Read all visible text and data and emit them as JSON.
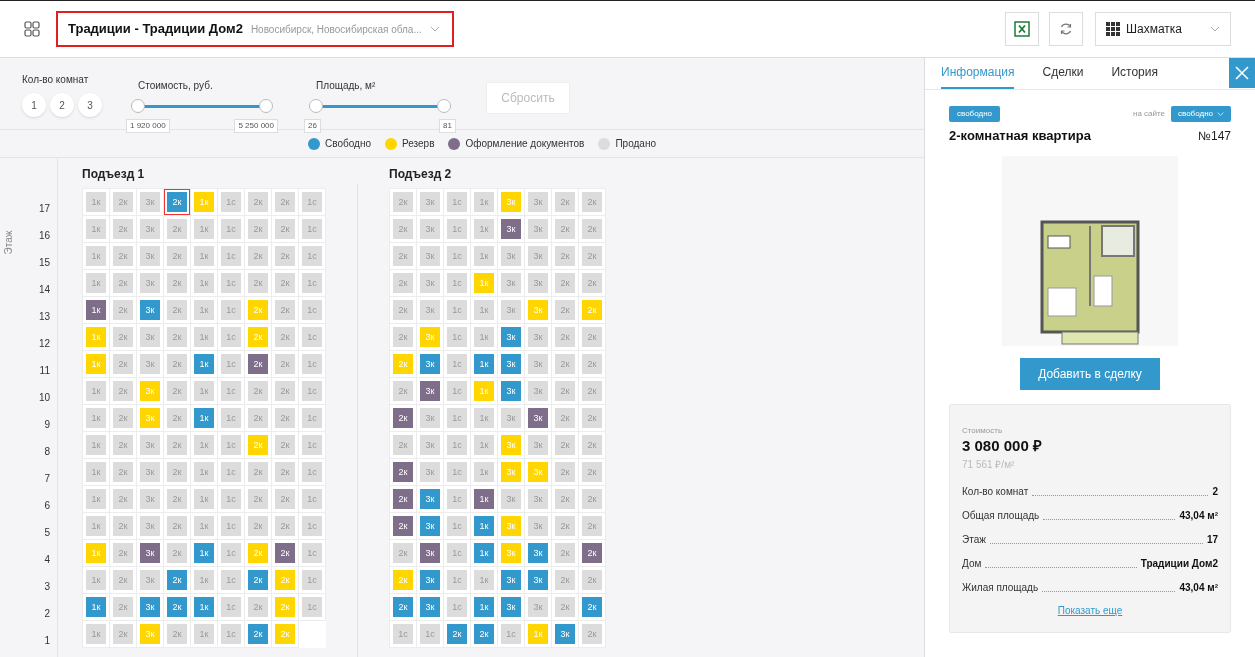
{
  "header": {
    "project": "Традиции - Традиции Дом2",
    "location": "Новосибирск, Новосибирская обла...",
    "view": "Шахматка"
  },
  "filters": {
    "rooms_label": "Кол-во комнат",
    "rooms": [
      {
        "label": "1",
        "selected": false
      },
      {
        "label": "2",
        "selected": false
      },
      {
        "label": "3",
        "selected": false
      }
    ],
    "sliders": [
      {
        "label": "Стоимость, руб.",
        "thumbs": [
          {
            "level": 0,
            "reading": "1 920 000"
          },
          {
            "level": 1,
            "reading": "5 250 000"
          }
        ]
      },
      {
        "label": "Площадь, м²",
        "thumbs": [
          {
            "level": 0,
            "reading": "26"
          },
          {
            "level": 1,
            "reading": "81"
          }
        ]
      }
    ],
    "reset": "Сбросить"
  },
  "legend": [
    {
      "kind": "free",
      "label": "Свободно",
      "color": "#3399cc"
    },
    {
      "kind": "reserve",
      "label": "Резерв",
      "color": "#ffd600"
    },
    {
      "kind": "docs",
      "label": "Оформление документов",
      "color": "#7e6e8a"
    },
    {
      "kind": "sold",
      "label": "Продано",
      "color": "#dcdcdc"
    }
  ],
  "floor_axis": "Этаж",
  "floors": [
    "17",
    "16",
    "15",
    "14",
    "13",
    "12",
    "11",
    "10",
    "9",
    "8",
    "7",
    "6",
    "5",
    "4",
    "3",
    "2",
    "1"
  ],
  "sections": [
    {
      "title": "Подъезд 1",
      "rows": [
        [
          {
            "label": "1к",
            "kind": "sold",
            "selected": false
          },
          {
            "label": "2к",
            "kind": "sold",
            "selected": false
          },
          {
            "label": "3к",
            "kind": "sold",
            "selected": false
          },
          {
            "label": "2к",
            "kind": "free",
            "selected": true
          },
          {
            "label": "1к",
            "kind": "reserve",
            "selected": false
          },
          {
            "label": "1с",
            "kind": "sold",
            "selected": false
          },
          {
            "label": "2к",
            "kind": "sold",
            "selected": false
          },
          {
            "label": "2к",
            "kind": "sold",
            "selected": false
          },
          {
            "label": "1с",
            "kind": "sold",
            "selected": false
          }
        ],
        [
          {
            "label": "1к",
            "kind": "sold",
            "selected": false
          },
          {
            "label": "2к",
            "kind": "sold",
            "selected": false
          },
          {
            "label": "3к",
            "kind": "sold",
            "selected": false
          },
          {
            "label": "2к",
            "kind": "sold",
            "selected": false
          },
          {
            "label": "1к",
            "kind": "sold",
            "selected": false
          },
          {
            "label": "1с",
            "kind": "sold",
            "selected": false
          },
          {
            "label": "2к",
            "kind": "sold",
            "selected": false
          },
          {
            "label": "2к",
            "kind": "sold",
            "selected": false
          },
          {
            "label": "1с",
            "kind": "sold",
            "selected": false
          }
        ],
        [
          {
            "label": "1к",
            "kind": "sold",
            "selected": false
          },
          {
            "label": "2к",
            "kind": "sold",
            "selected": false
          },
          {
            "label": "3к",
            "kind": "sold",
            "selected": false
          },
          {
            "label": "2к",
            "kind": "sold",
            "selected": false
          },
          {
            "label": "1к",
            "kind": "sold",
            "selected": false
          },
          {
            "label": "1с",
            "kind": "sold",
            "selected": false
          },
          {
            "label": "2к",
            "kind": "sold",
            "selected": false
          },
          {
            "label": "2к",
            "kind": "sold",
            "selected": false
          },
          {
            "label": "1с",
            "kind": "sold",
            "selected": false
          }
        ],
        [
          {
            "label": "1к",
            "kind": "sold",
            "selected": false
          },
          {
            "label": "2к",
            "kind": "sold",
            "selected": false
          },
          {
            "label": "3к",
            "kind": "sold",
            "selected": false
          },
          {
            "label": "2к",
            "kind": "sold",
            "selected": false
          },
          {
            "label": "1к",
            "kind": "sold",
            "selected": false
          },
          {
            "label": "1с",
            "kind": "sold",
            "selected": false
          },
          {
            "label": "2к",
            "kind": "sold",
            "selected": false
          },
          {
            "label": "2к",
            "kind": "sold",
            "selected": false
          },
          {
            "label": "1с",
            "kind": "sold",
            "selected": false
          }
        ],
        [
          {
            "label": "1к",
            "kind": "docs",
            "selected": false
          },
          {
            "label": "2к",
            "kind": "sold",
            "selected": false
          },
          {
            "label": "3к",
            "kind": "free",
            "selected": false
          },
          {
            "label": "2к",
            "kind": "sold",
            "selected": false
          },
          {
            "label": "1к",
            "kind": "sold",
            "selected": false
          },
          {
            "label": "1с",
            "kind": "sold",
            "selected": false
          },
          {
            "label": "2к",
            "kind": "reserve",
            "selected": false
          },
          {
            "label": "2к",
            "kind": "sold",
            "selected": false
          },
          {
            "label": "1с",
            "kind": "sold",
            "selected": false
          }
        ],
        [
          {
            "label": "1к",
            "kind": "reserve",
            "selected": false
          },
          {
            "label": "2к",
            "kind": "sold",
            "selected": false
          },
          {
            "label": "3к",
            "kind": "sold",
            "selected": false
          },
          {
            "label": "2к",
            "kind": "sold",
            "selected": false
          },
          {
            "label": "1к",
            "kind": "sold",
            "selected": false
          },
          {
            "label": "1с",
            "kind": "sold",
            "selected": false
          },
          {
            "label": "2к",
            "kind": "reserve",
            "selected": false
          },
          {
            "label": "2к",
            "kind": "sold",
            "selected": false
          },
          {
            "label": "1с",
            "kind": "sold",
            "selected": false
          }
        ],
        [
          {
            "label": "1к",
            "kind": "reserve",
            "selected": false
          },
          {
            "label": "2к",
            "kind": "sold",
            "selected": false
          },
          {
            "label": "3к",
            "kind": "sold",
            "selected": false
          },
          {
            "label": "2к",
            "kind": "sold",
            "selected": false
          },
          {
            "label": "1к",
            "kind": "free",
            "selected": false
          },
          {
            "label": "1с",
            "kind": "sold",
            "selected": false
          },
          {
            "label": "2к",
            "kind": "docs",
            "selected": false
          },
          {
            "label": "2к",
            "kind": "sold",
            "selected": false
          },
          {
            "label": "1с",
            "kind": "sold",
            "selected": false
          }
        ],
        [
          {
            "label": "1к",
            "kind": "sold",
            "selected": false
          },
          {
            "label": "2к",
            "kind": "sold",
            "selected": false
          },
          {
            "label": "3к",
            "kind": "reserve",
            "selected": false
          },
          {
            "label": "2к",
            "kind": "sold",
            "selected": false
          },
          {
            "label": "1к",
            "kind": "sold",
            "selected": false
          },
          {
            "label": "1с",
            "kind": "sold",
            "selected": false
          },
          {
            "label": "2к",
            "kind": "sold",
            "selected": false
          },
          {
            "label": "2к",
            "kind": "sold",
            "selected": false
          },
          {
            "label": "1с",
            "kind": "sold",
            "selected": false
          }
        ],
        [
          {
            "label": "1к",
            "kind": "sold",
            "selected": false
          },
          {
            "label": "2к",
            "kind": "sold",
            "selected": false
          },
          {
            "label": "3к",
            "kind": "reserve",
            "selected": false
          },
          {
            "label": "2к",
            "kind": "sold",
            "selected": false
          },
          {
            "label": "1к",
            "kind": "free",
            "selected": false
          },
          {
            "label": "1с",
            "kind": "sold",
            "selected": false
          },
          {
            "label": "2к",
            "kind": "sold",
            "selected": false
          },
          {
            "label": "2к",
            "kind": "sold",
            "selected": false
          },
          {
            "label": "1с",
            "kind": "sold",
            "selected": false
          }
        ],
        [
          {
            "label": "1к",
            "kind": "sold",
            "selected": false
          },
          {
            "label": "2к",
            "kind": "sold",
            "selected": false
          },
          {
            "label": "3к",
            "kind": "sold",
            "selected": false
          },
          {
            "label": "2к",
            "kind": "sold",
            "selected": false
          },
          {
            "label": "1к",
            "kind": "sold",
            "selected": false
          },
          {
            "label": "1с",
            "kind": "sold",
            "selected": false
          },
          {
            "label": "2к",
            "kind": "reserve",
            "selected": false
          },
          {
            "label": "2к",
            "kind": "sold",
            "selected": false
          },
          {
            "label": "1с",
            "kind": "sold",
            "selected": false
          }
        ],
        [
          {
            "label": "1к",
            "kind": "sold",
            "selected": false
          },
          {
            "label": "2к",
            "kind": "sold",
            "selected": false
          },
          {
            "label": "3к",
            "kind": "sold",
            "selected": false
          },
          {
            "label": "2к",
            "kind": "sold",
            "selected": false
          },
          {
            "label": "1к",
            "kind": "sold",
            "selected": false
          },
          {
            "label": "1с",
            "kind": "sold",
            "selected": false
          },
          {
            "label": "2к",
            "kind": "sold",
            "selected": false
          },
          {
            "label": "2к",
            "kind": "sold",
            "selected": false
          },
          {
            "label": "1с",
            "kind": "sold",
            "selected": false
          }
        ],
        [
          {
            "label": "1к",
            "kind": "sold",
            "selected": false
          },
          {
            "label": "2к",
            "kind": "sold",
            "selected": false
          },
          {
            "label": "3к",
            "kind": "sold",
            "selected": false
          },
          {
            "label": "2к",
            "kind": "sold",
            "selected": false
          },
          {
            "label": "1к",
            "kind": "sold",
            "selected": false
          },
          {
            "label": "1с",
            "kind": "sold",
            "selected": false
          },
          {
            "label": "2к",
            "kind": "sold",
            "selected": false
          },
          {
            "label": "2к",
            "kind": "sold",
            "selected": false
          },
          {
            "label": "1с",
            "kind": "sold",
            "selected": false
          }
        ],
        [
          {
            "label": "1к",
            "kind": "sold",
            "selected": false
          },
          {
            "label": "2к",
            "kind": "sold",
            "selected": false
          },
          {
            "label": "3к",
            "kind": "sold",
            "selected": false
          },
          {
            "label": "2к",
            "kind": "sold",
            "selected": false
          },
          {
            "label": "1к",
            "kind": "sold",
            "selected": false
          },
          {
            "label": "1с",
            "kind": "sold",
            "selected": false
          },
          {
            "label": "2к",
            "kind": "sold",
            "selected": false
          },
          {
            "label": "2к",
            "kind": "sold",
            "selected": false
          },
          {
            "label": "1с",
            "kind": "sold",
            "selected": false
          }
        ],
        [
          {
            "label": "1к",
            "kind": "reserve",
            "selected": false
          },
          {
            "label": "2к",
            "kind": "sold",
            "selected": false
          },
          {
            "label": "3к",
            "kind": "docs",
            "selected": false
          },
          {
            "label": "2к",
            "kind": "sold",
            "selected": false
          },
          {
            "label": "1к",
            "kind": "free",
            "selected": false
          },
          {
            "label": "1с",
            "kind": "sold",
            "selected": false
          },
          {
            "label": "2к",
            "kind": "reserve",
            "selected": false
          },
          {
            "label": "2к",
            "kind": "docs",
            "selected": false
          },
          {
            "label": "1с",
            "kind": "sold",
            "selected": false
          }
        ],
        [
          {
            "label": "1к",
            "kind": "sold",
            "selected": false
          },
          {
            "label": "2к",
            "kind": "sold",
            "selected": false
          },
          {
            "label": "3к",
            "kind": "sold",
            "selected": false
          },
          {
            "label": "2к",
            "kind": "free",
            "selected": false
          },
          {
            "label": "1к",
            "kind": "sold",
            "selected": false
          },
          {
            "label": "1с",
            "kind": "sold",
            "selected": false
          },
          {
            "label": "2к",
            "kind": "free",
            "selected": false
          },
          {
            "label": "2к",
            "kind": "reserve",
            "selected": false
          },
          {
            "label": "1с",
            "kind": "sold",
            "selected": false
          }
        ],
        [
          {
            "label": "1к",
            "kind": "free",
            "selected": false
          },
          {
            "label": "2к",
            "kind": "sold",
            "selected": false
          },
          {
            "label": "3к",
            "kind": "free",
            "selected": false
          },
          {
            "label": "2к",
            "kind": "free",
            "selected": false
          },
          {
            "label": "1к",
            "kind": "free",
            "selected": false
          },
          {
            "label": "1с",
            "kind": "sold",
            "selected": false
          },
          {
            "label": "2к",
            "kind": "sold",
            "selected": false
          },
          {
            "label": "2к",
            "kind": "reserve",
            "selected": false
          },
          {
            "label": "1с",
            "kind": "sold",
            "selected": false
          }
        ],
        [
          {
            "label": "1к",
            "kind": "sold",
            "selected": false
          },
          {
            "label": "2к",
            "kind": "sold",
            "selected": false
          },
          {
            "label": "3к",
            "kind": "reserve",
            "selected": false
          },
          {
            "label": "2к",
            "kind": "sold",
            "selected": false
          },
          {
            "label": "1к",
            "kind": "sold",
            "selected": false
          },
          {
            "label": "1с",
            "kind": "sold",
            "selected": false
          },
          {
            "label": "2к",
            "kind": "free",
            "selected": false
          },
          {
            "label": "2к",
            "kind": "reserve",
            "selected": false
          }
        ]
      ]
    },
    {
      "title": "Подъезд 2",
      "rows": [
        [
          {
            "label": "2к",
            "kind": "sold",
            "selected": false
          },
          {
            "label": "3к",
            "kind": "sold",
            "selected": false
          },
          {
            "label": "1с",
            "kind": "sold",
            "selected": false
          },
          {
            "label": "1к",
            "kind": "sold",
            "selected": false
          },
          {
            "label": "3к",
            "kind": "reserve",
            "selected": false
          },
          {
            "label": "3к",
            "kind": "sold",
            "selected": false
          },
          {
            "label": "2к",
            "kind": "sold",
            "selected": false
          },
          {
            "label": "2к",
            "kind": "sold",
            "selected": false
          }
        ],
        [
          {
            "label": "2к",
            "kind": "sold",
            "selected": false
          },
          {
            "label": "3к",
            "kind": "sold",
            "selected": false
          },
          {
            "label": "1с",
            "kind": "sold",
            "selected": false
          },
          {
            "label": "1к",
            "kind": "sold",
            "selected": false
          },
          {
            "label": "3к",
            "kind": "docs",
            "selected": false
          },
          {
            "label": "3к",
            "kind": "sold",
            "selected": false
          },
          {
            "label": "2к",
            "kind": "sold",
            "selected": false
          },
          {
            "label": "2к",
            "kind": "sold",
            "selected": false
          }
        ],
        [
          {
            "label": "2к",
            "kind": "sold",
            "selected": false
          },
          {
            "label": "3к",
            "kind": "sold",
            "selected": false
          },
          {
            "label": "1с",
            "kind": "sold",
            "selected": false
          },
          {
            "label": "1к",
            "kind": "sold",
            "selected": false
          },
          {
            "label": "3к",
            "kind": "sold",
            "selected": false
          },
          {
            "label": "3к",
            "kind": "sold",
            "selected": false
          },
          {
            "label": "2к",
            "kind": "sold",
            "selected": false
          },
          {
            "label": "2к",
            "kind": "sold",
            "selected": false
          }
        ],
        [
          {
            "label": "2к",
            "kind": "sold",
            "selected": false
          },
          {
            "label": "3к",
            "kind": "sold",
            "selected": false
          },
          {
            "label": "1с",
            "kind": "sold",
            "selected": false
          },
          {
            "label": "1к",
            "kind": "reserve",
            "selected": false
          },
          {
            "label": "3к",
            "kind": "sold",
            "selected": false
          },
          {
            "label": "3к",
            "kind": "sold",
            "selected": false
          },
          {
            "label": "2к",
            "kind": "sold",
            "selected": false
          },
          {
            "label": "2к",
            "kind": "sold",
            "selected": false
          }
        ],
        [
          {
            "label": "2к",
            "kind": "sold",
            "selected": false
          },
          {
            "label": "3к",
            "kind": "sold",
            "selected": false
          },
          {
            "label": "1с",
            "kind": "sold",
            "selected": false
          },
          {
            "label": "1к",
            "kind": "sold",
            "selected": false
          },
          {
            "label": "3к",
            "kind": "sold",
            "selected": false
          },
          {
            "label": "3к",
            "kind": "reserve",
            "selected": false
          },
          {
            "label": "2к",
            "kind": "sold",
            "selected": false
          },
          {
            "label": "2к",
            "kind": "reserve",
            "selected": false
          }
        ],
        [
          {
            "label": "2к",
            "kind": "sold",
            "selected": false
          },
          {
            "label": "3к",
            "kind": "reserve",
            "selected": false
          },
          {
            "label": "1с",
            "kind": "sold",
            "selected": false
          },
          {
            "label": "1к",
            "kind": "sold",
            "selected": false
          },
          {
            "label": "3к",
            "kind": "free",
            "selected": false
          },
          {
            "label": "3к",
            "kind": "sold",
            "selected": false
          },
          {
            "label": "2к",
            "kind": "sold",
            "selected": false
          },
          {
            "label": "2к",
            "kind": "sold",
            "selected": false
          }
        ],
        [
          {
            "label": "2к",
            "kind": "reserve",
            "selected": false
          },
          {
            "label": "3к",
            "kind": "free",
            "selected": false
          },
          {
            "label": "1с",
            "kind": "sold",
            "selected": false
          },
          {
            "label": "1к",
            "kind": "free",
            "selected": false
          },
          {
            "label": "3к",
            "kind": "free",
            "selected": false
          },
          {
            "label": "3к",
            "kind": "sold",
            "selected": false
          },
          {
            "label": "2к",
            "kind": "sold",
            "selected": false
          },
          {
            "label": "2к",
            "kind": "sold",
            "selected": false
          }
        ],
        [
          {
            "label": "2к",
            "kind": "sold",
            "selected": false
          },
          {
            "label": "3к",
            "kind": "docs",
            "selected": false
          },
          {
            "label": "1с",
            "kind": "sold",
            "selected": false
          },
          {
            "label": "1к",
            "kind": "reserve",
            "selected": false
          },
          {
            "label": "3к",
            "kind": "free",
            "selected": false
          },
          {
            "label": "3к",
            "kind": "sold",
            "selected": false
          },
          {
            "label": "2к",
            "kind": "sold",
            "selected": false
          },
          {
            "label": "2к",
            "kind": "sold",
            "selected": false
          }
        ],
        [
          {
            "label": "2к",
            "kind": "docs",
            "selected": false
          },
          {
            "label": "3к",
            "kind": "sold",
            "selected": false
          },
          {
            "label": "1с",
            "kind": "sold",
            "selected": false
          },
          {
            "label": "1к",
            "kind": "sold",
            "selected": false
          },
          {
            "label": "3к",
            "kind": "sold",
            "selected": false
          },
          {
            "label": "3к",
            "kind": "docs",
            "selected": false
          },
          {
            "label": "2к",
            "kind": "sold",
            "selected": false
          },
          {
            "label": "2к",
            "kind": "sold",
            "selected": false
          }
        ],
        [
          {
            "label": "2к",
            "kind": "sold",
            "selected": false
          },
          {
            "label": "3к",
            "kind": "sold",
            "selected": false
          },
          {
            "label": "1с",
            "kind": "sold",
            "selected": false
          },
          {
            "label": "1к",
            "kind": "sold",
            "selected": false
          },
          {
            "label": "3к",
            "kind": "reserve",
            "selected": false
          },
          {
            "label": "3к",
            "kind": "sold",
            "selected": false
          },
          {
            "label": "2к",
            "kind": "sold",
            "selected": false
          },
          {
            "label": "2к",
            "kind": "sold",
            "selected": false
          }
        ],
        [
          {
            "label": "2к",
            "kind": "docs",
            "selected": false
          },
          {
            "label": "3к",
            "kind": "sold",
            "selected": false
          },
          {
            "label": "1с",
            "kind": "sold",
            "selected": false
          },
          {
            "label": "1к",
            "kind": "sold",
            "selected": false
          },
          {
            "label": "3к",
            "kind": "reserve",
            "selected": false
          },
          {
            "label": "3к",
            "kind": "reserve",
            "selected": false
          },
          {
            "label": "2к",
            "kind": "sold",
            "selected": false
          },
          {
            "label": "2к",
            "kind": "sold",
            "selected": false
          }
        ],
        [
          {
            "label": "2к",
            "kind": "docs",
            "selected": false
          },
          {
            "label": "3к",
            "kind": "free",
            "selected": false
          },
          {
            "label": "1с",
            "kind": "sold",
            "selected": false
          },
          {
            "label": "1к",
            "kind": "docs",
            "selected": false
          },
          {
            "label": "3к",
            "kind": "sold",
            "selected": false
          },
          {
            "label": "3к",
            "kind": "sold",
            "selected": false
          },
          {
            "label": "2к",
            "kind": "sold",
            "selected": false
          },
          {
            "label": "2к",
            "kind": "sold",
            "selected": false
          }
        ],
        [
          {
            "label": "2к",
            "kind": "docs",
            "selected": false
          },
          {
            "label": "3к",
            "kind": "free",
            "selected": false
          },
          {
            "label": "1с",
            "kind": "sold",
            "selected": false
          },
          {
            "label": "1к",
            "kind": "free",
            "selected": false
          },
          {
            "label": "3к",
            "kind": "reserve",
            "selected": false
          },
          {
            "label": "3к",
            "kind": "sold",
            "selected": false
          },
          {
            "label": "2к",
            "kind": "sold",
            "selected": false
          },
          {
            "label": "2к",
            "kind": "sold",
            "selected": false
          }
        ],
        [
          {
            "label": "2к",
            "kind": "sold",
            "selected": false
          },
          {
            "label": "3к",
            "kind": "docs",
            "selected": false
          },
          {
            "label": "1с",
            "kind": "sold",
            "selected": false
          },
          {
            "label": "1к",
            "kind": "free",
            "selected": false
          },
          {
            "label": "3к",
            "kind": "reserve",
            "selected": false
          },
          {
            "label": "3к",
            "kind": "free",
            "selected": false
          },
          {
            "label": "2к",
            "kind": "sold",
            "selected": false
          },
          {
            "label": "2к",
            "kind": "docs",
            "selected": false
          }
        ],
        [
          {
            "label": "2к",
            "kind": "reserve",
            "selected": false
          },
          {
            "label": "3к",
            "kind": "free",
            "selected": false
          },
          {
            "label": "1с",
            "kind": "sold",
            "selected": false
          },
          {
            "label": "1к",
            "kind": "sold",
            "selected": false
          },
          {
            "label": "3к",
            "kind": "free",
            "selected": false
          },
          {
            "label": "3к",
            "kind": "free",
            "selected": false
          },
          {
            "label": "2к",
            "kind": "sold",
            "selected": false
          },
          {
            "label": "2к",
            "kind": "sold",
            "selected": false
          }
        ],
        [
          {
            "label": "2к",
            "kind": "free",
            "selected": false
          },
          {
            "label": "3к",
            "kind": "free",
            "selected": false
          },
          {
            "label": "1с",
            "kind": "sold",
            "selected": false
          },
          {
            "label": "1к",
            "kind": "free",
            "selected": false
          },
          {
            "label": "3к",
            "kind": "free",
            "selected": false
          },
          {
            "label": "3к",
            "kind": "sold",
            "selected": false
          },
          {
            "label": "2к",
            "kind": "sold",
            "selected": false
          },
          {
            "label": "2к",
            "kind": "free",
            "selected": false
          }
        ],
        [
          {
            "label": "1с",
            "kind": "sold",
            "selected": false
          },
          {
            "label": "1с",
            "kind": "sold",
            "selected": false
          },
          {
            "label": "2к",
            "kind": "free",
            "selected": false
          },
          {
            "label": "2к",
            "kind": "free",
            "selected": false
          },
          {
            "label": "1с",
            "kind": "sold",
            "selected": false
          },
          {
            "label": "1к",
            "kind": "reserve",
            "selected": false
          },
          {
            "label": "3к",
            "kind": "free",
            "selected": false
          },
          {
            "label": "2к",
            "kind": "sold",
            "selected": false
          }
        ]
      ]
    }
  ],
  "panel": {
    "tabs": [
      {
        "label": "Информация",
        "selected": true
      },
      {
        "label": "Сделки",
        "selected": false
      },
      {
        "label": "История",
        "selected": false
      }
    ],
    "status": "свободно",
    "site_label": "на сайте",
    "site_status": "свободно",
    "title": "2-комнатная квартира",
    "number": "№147",
    "add_button": "Добавить в сделку",
    "price_label": "Стоимость",
    "price": "3 080 000 ₽",
    "price_per_m2": "71 561 ₽/м²",
    "attributes": [
      {
        "name": "Кол-во комнат",
        "value": "2"
      },
      {
        "name": "Общая площадь",
        "value": "43,04 м²"
      },
      {
        "name": "Этаж",
        "value": "17"
      },
      {
        "name": "Дом",
        "value": "Традиции Дом2"
      },
      {
        "name": "Жилая площадь",
        "value": "43,04 м²"
      }
    ],
    "more_link": "Показать еще"
  }
}
